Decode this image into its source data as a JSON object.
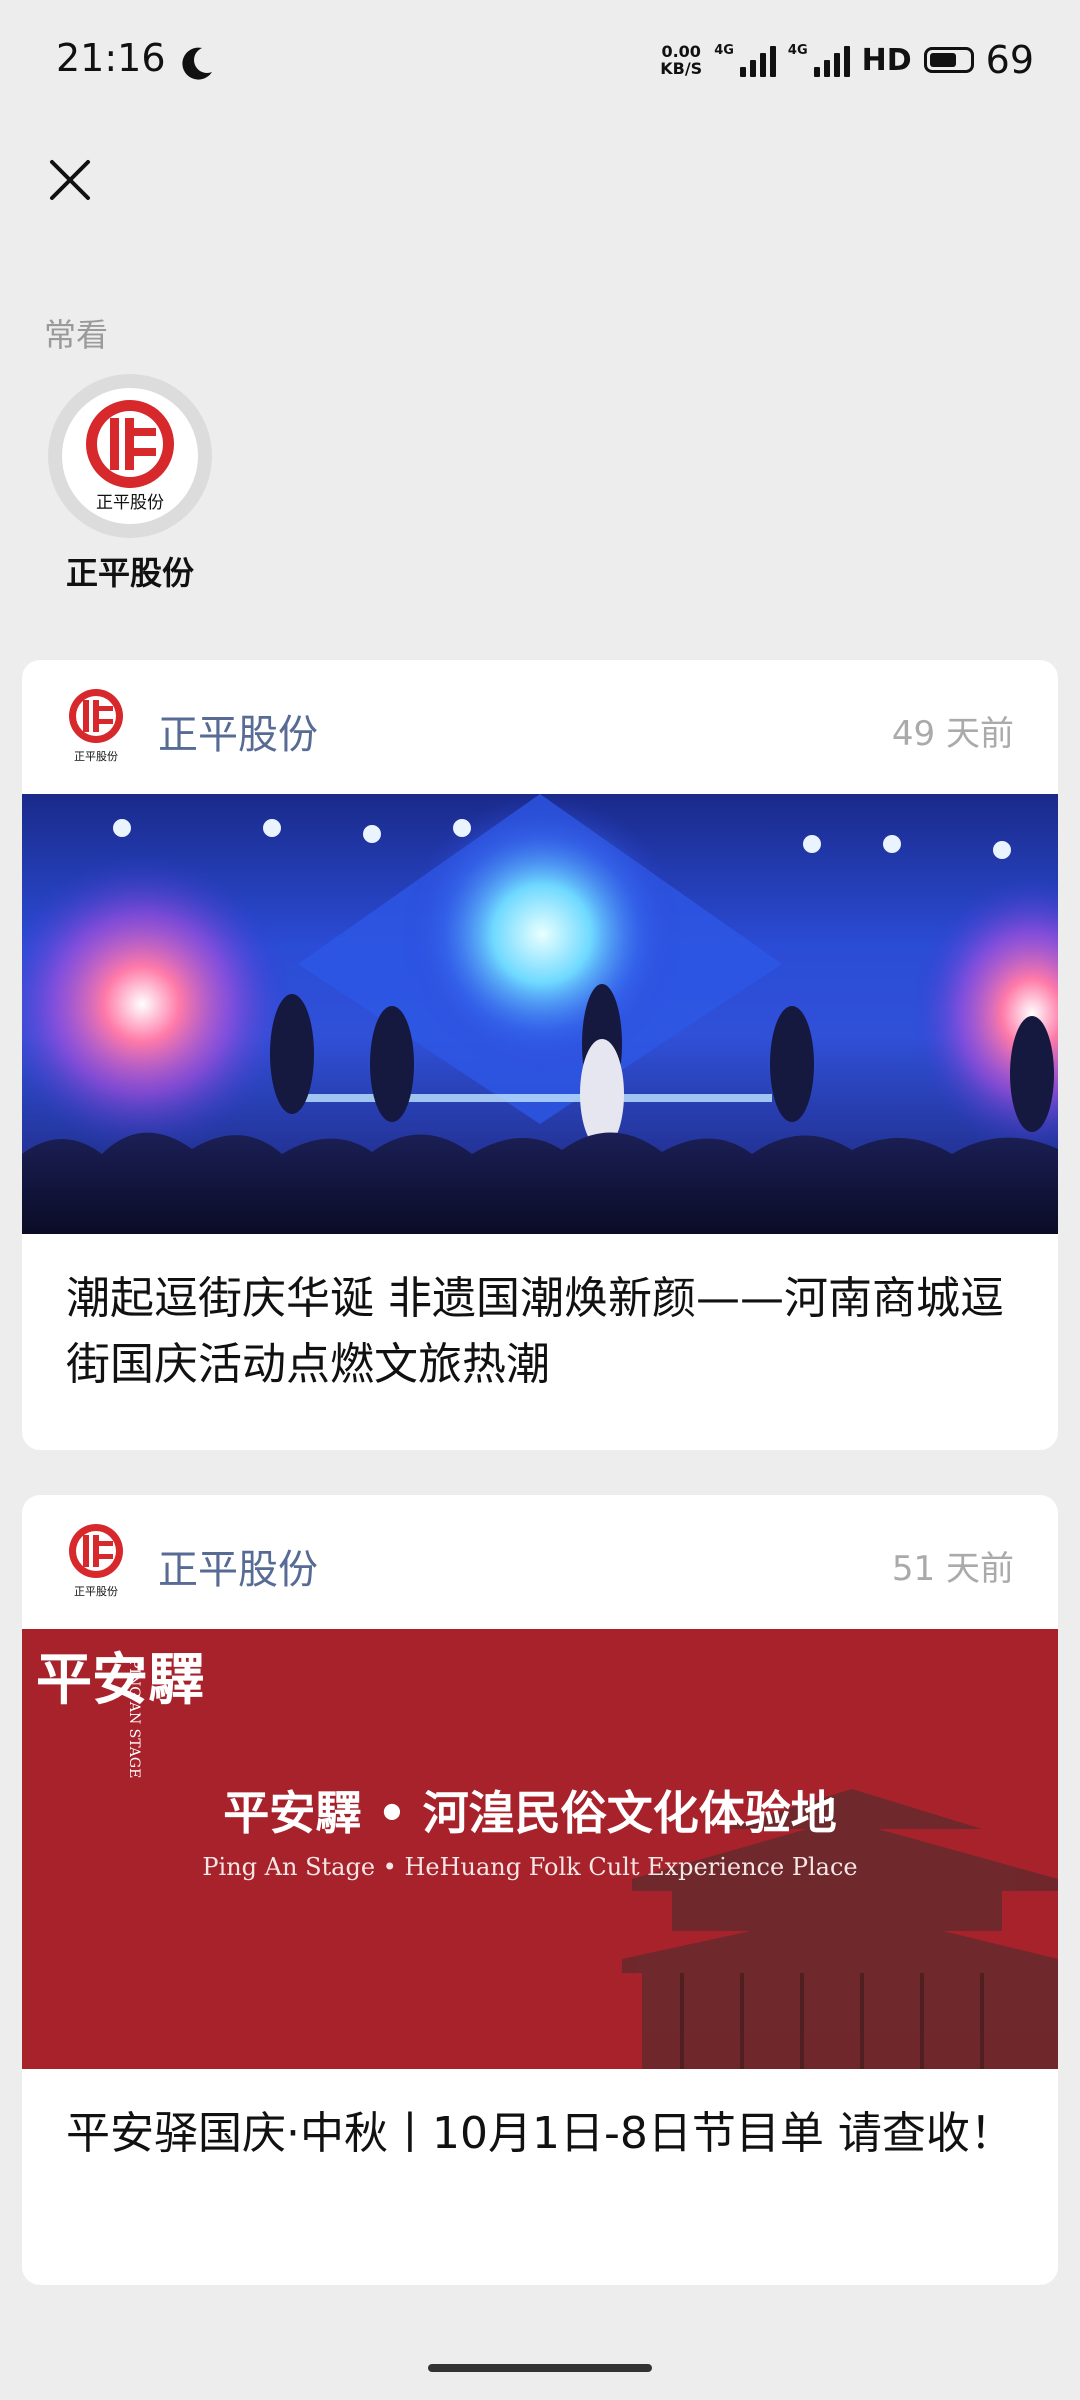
{
  "status_bar": {
    "time": "21:16",
    "net_speed_value": "0.00",
    "net_speed_unit": "KB/S",
    "signal1_label": "4G",
    "signal2_label": "4G",
    "hd_label": "HD",
    "battery_level": "69"
  },
  "header": {
    "close_icon": "close-icon"
  },
  "frequent": {
    "label": "常看",
    "accounts": [
      {
        "name": "正平股份",
        "logo_text": "正平股份"
      }
    ]
  },
  "articles": [
    {
      "account": "正平股份",
      "logo_text": "正平股份",
      "time": "49 天前",
      "title": "潮起逗街庆华诞 非遗国潮焕新颜——河南商城逗街国庆活动点燃文旅热潮"
    },
    {
      "account": "正平股份",
      "logo_text": "正平股份",
      "time": "51 天前",
      "title": "平安驿国庆·中秋丨10月1日-8日节目单 请查收！",
      "cover_title_cn": "平安驛 • 河湟民俗文化体验地",
      "cover_title_en": "Ping An Stage • HeHuang Folk Cult Experience Place",
      "cover_vertical_cn": "平安驛",
      "cover_vertical_en": "PING AN STAGE"
    }
  ],
  "colors": {
    "brand_red": "#d7282c",
    "link_blue": "#576b95",
    "background": "#ededed"
  }
}
